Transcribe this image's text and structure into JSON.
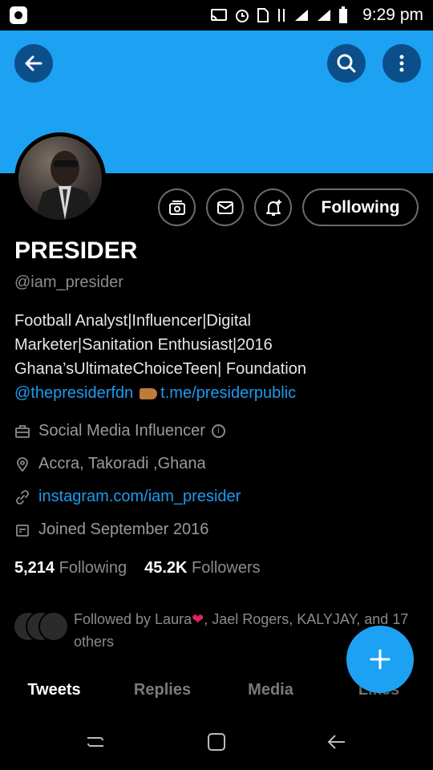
{
  "status_bar": {
    "time": "9:29 pm",
    "icons": [
      "cast-icon",
      "alarm-icon",
      "sim-icon",
      "data-icon",
      "signal-icon",
      "signal-icon",
      "battery-icon"
    ]
  },
  "header": {
    "back_icon": "arrow-left-icon",
    "search_icon": "search-icon",
    "more_icon": "more-vertical-icon",
    "banner_color": "#1da1f2"
  },
  "profile": {
    "name": "PRESIDER",
    "handle": "@iam_presider",
    "follow_button": "Following",
    "bio": {
      "line1": "Football Analyst|Influencer|Digital",
      "line2": "Marketer|Sanitation Enthusiast|2016",
      "line3": "Ghana’sUltimateChoiceTeen| Foundation",
      "mention": "@thepresiderfdn",
      "link": "t.me/presiderpublic"
    },
    "category": "Social Media Influencer",
    "location": "Accra, Takoradi ,Ghana",
    "website": "instagram.com/iam_presider",
    "joined": "Joined September 2016",
    "following_count": "5,214",
    "following_label": "Following",
    "followers_count": "45.2K",
    "followers_label": "Followers",
    "followed_by_prefix": "Followed by Laura",
    "followed_by_rest": ", Jael Rogers, KALYJAY, and 17 others"
  },
  "tabs": [
    {
      "label": "Tweets"
    },
    {
      "label": "Replies"
    },
    {
      "label": "Media"
    },
    {
      "label": "Likes"
    }
  ],
  "fab_icon": "plus-icon",
  "colors": {
    "accent": "#1da1f2",
    "link": "#1d9bf0",
    "heart": "#e0245e"
  }
}
